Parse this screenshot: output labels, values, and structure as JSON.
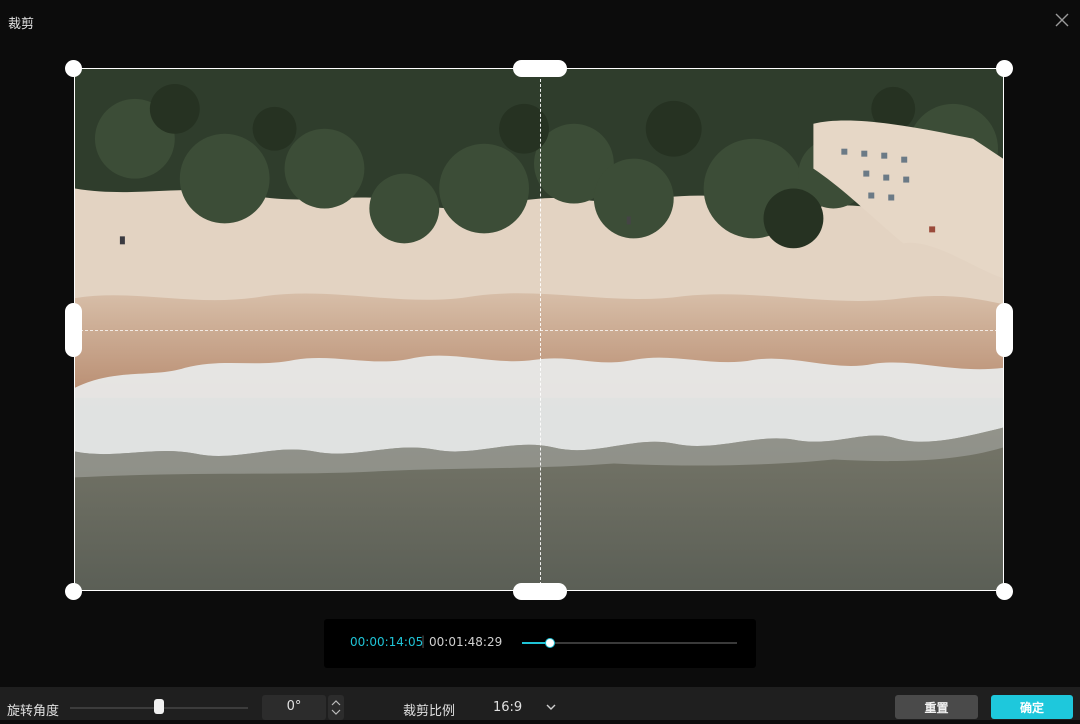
{
  "window": {
    "title": "裁剪"
  },
  "icons": {
    "close": "close-icon",
    "stepper_up": "chevron-up-icon",
    "stepper_down": "chevron-down-icon",
    "dropdown": "chevron-down-icon"
  },
  "player": {
    "current_time": "00:00:14:05",
    "separator": "|",
    "total_time": "00:01:48:29",
    "progress": 0.13
  },
  "rotation": {
    "label": "旋转角度",
    "value": "0°",
    "slider_level": 0.5
  },
  "crop_ratio": {
    "label": "裁剪比例",
    "value": "16:9"
  },
  "buttons": {
    "reset": "重置",
    "confirm": "确定"
  },
  "colors": {
    "accent": "#1ec8dc",
    "background": "#0c0c0c",
    "toolbar": "#1f1f1f"
  }
}
